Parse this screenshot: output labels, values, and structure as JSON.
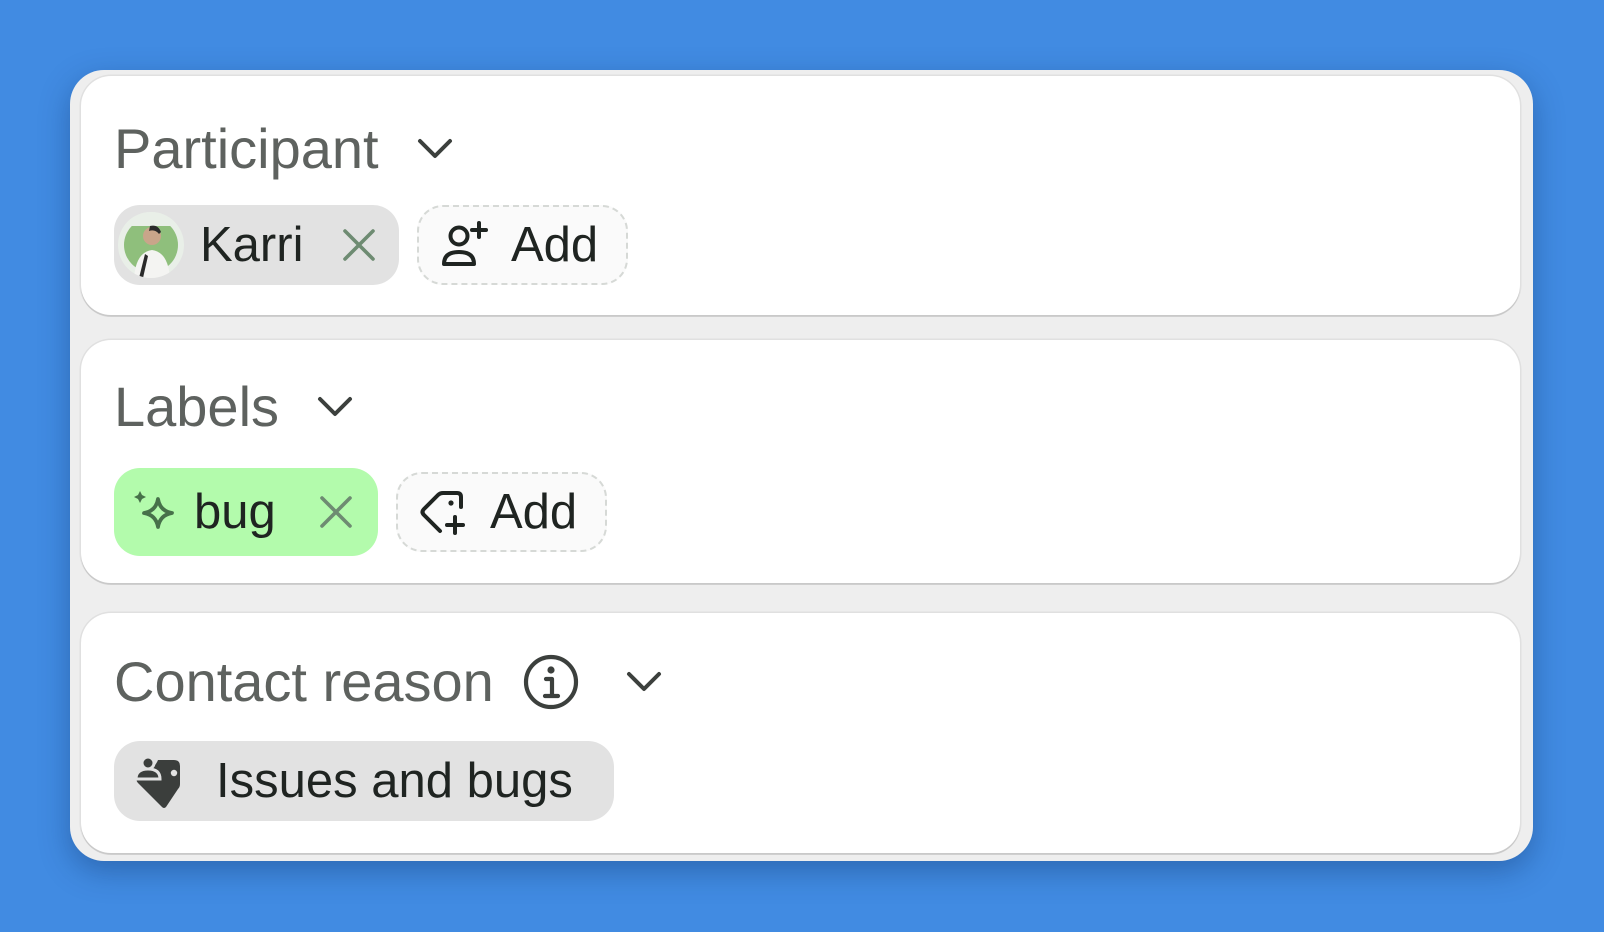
{
  "participant": {
    "heading": "Participant",
    "chip_name": "Karri",
    "add_label": "Add",
    "icons": {
      "toggle": "chevron-down-icon",
      "remove": "close-icon",
      "add": "user-plus-icon",
      "avatar": "avatar"
    }
  },
  "labels": {
    "heading": "Labels",
    "chip_label": "bug",
    "add_label": "Add",
    "chip_color": "#b3fbac",
    "icons": {
      "toggle": "chevron-down-icon",
      "chip": "sparkle-icon",
      "remove": "close-icon",
      "add": "tag-plus-icon"
    }
  },
  "contact_reason": {
    "heading": "Contact reason",
    "chip_label": "Issues and bugs",
    "icons": {
      "info": "info-icon",
      "toggle": "chevron-down-icon",
      "chip": "user-tag-icon"
    }
  },
  "colors": {
    "background": "#418be2",
    "panel": "#eeeeee",
    "card": "#ffffff",
    "heading_text": "#5e625f",
    "chip_gray": "#e2e2e2",
    "remove_icon": "#6e8b72"
  }
}
